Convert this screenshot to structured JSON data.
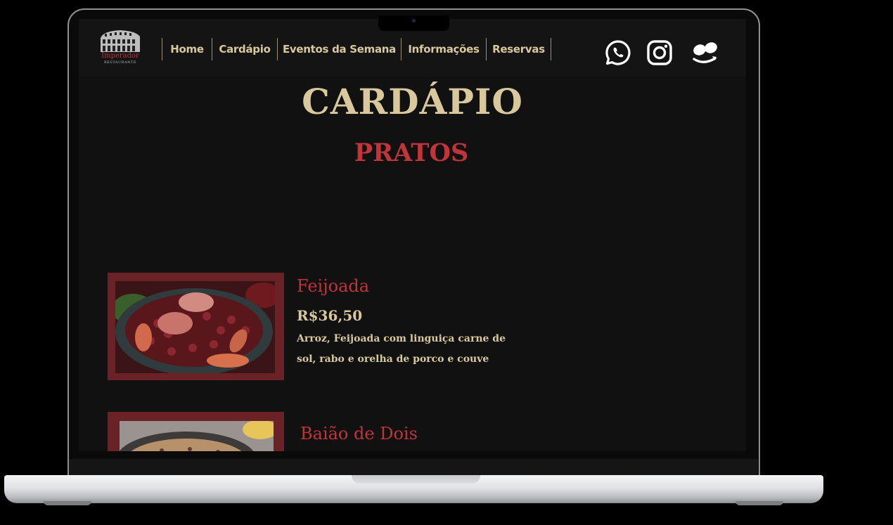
{
  "logo": {
    "name": "Imperador",
    "subtitle": "RESTAURANTE"
  },
  "nav": {
    "items": [
      {
        "label": "Home"
      },
      {
        "label": "Cardápio"
      },
      {
        "label": "Eventos da Semana"
      },
      {
        "label": "Informações"
      },
      {
        "label": "Reservas"
      }
    ]
  },
  "social": {
    "icons": [
      "whatsapp-icon",
      "instagram-icon",
      "ifood-icon"
    ]
  },
  "page_title": "CARDÁPIO",
  "section_title": "PRATOS",
  "dishes": [
    {
      "name": "Feijoada",
      "price": "R$36,50",
      "description_line1": "Arroz, Feijoada com linguiça carne de",
      "description_line2": "sol, rabo e orelha de porco e couve"
    },
    {
      "name": "Baião de Dois"
    }
  ],
  "colors": {
    "gold": "#d9c89c",
    "red": "#c0343a",
    "frame": "#6b2226",
    "background": "#111111"
  }
}
